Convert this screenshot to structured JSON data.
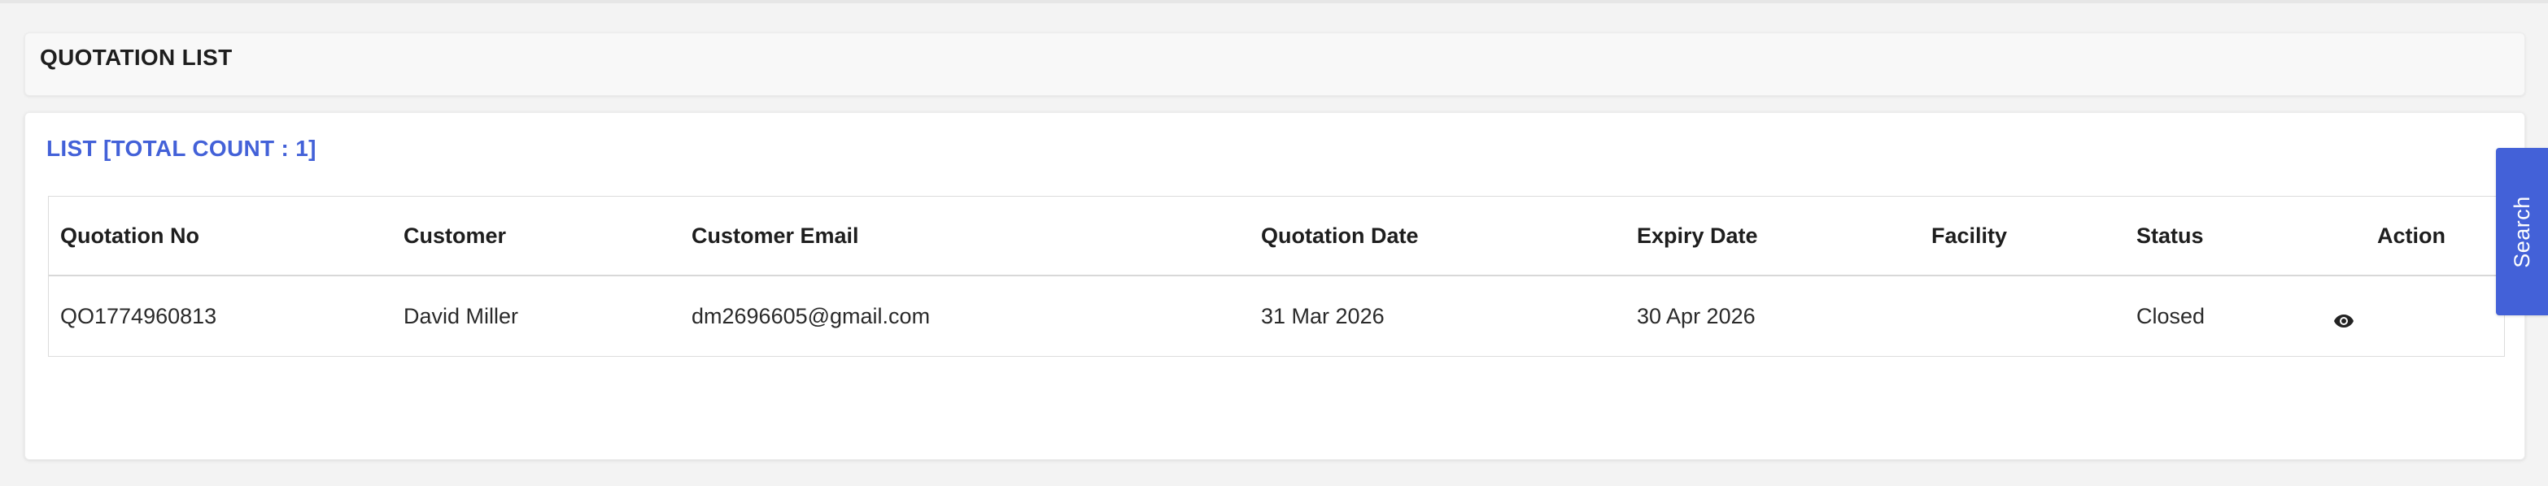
{
  "header": {
    "title": "QUOTATION LIST"
  },
  "list": {
    "heading": "LIST [TOTAL COUNT : 1]",
    "columns": [
      "Quotation No",
      "Customer",
      "Customer Email",
      "Quotation Date",
      "Expiry Date",
      "Facility",
      "Status",
      "Action"
    ],
    "rows": [
      {
        "quotation_no": "QO1774960813",
        "customer": "David Miller",
        "customer_email": "dm2696605@gmail.com",
        "quotation_date": "31 Mar 2026",
        "expiry_date": "30 Apr 2026",
        "facility": "",
        "status": "Closed",
        "action_icon": "eye-icon"
      }
    ]
  },
  "search_tab": {
    "label": "Search"
  },
  "colors": {
    "accent": "#4361d8",
    "background": "#f3f3f3",
    "card": "#ffffff"
  }
}
